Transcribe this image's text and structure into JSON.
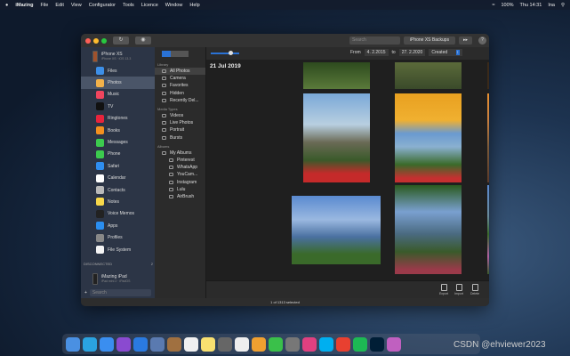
{
  "menubar": {
    "app": "iMazing",
    "items": [
      "File",
      "Edit",
      "View",
      "Configurator",
      "Tools",
      "Licence",
      "Window",
      "Help"
    ],
    "battery": "100%",
    "clock": "Thu 14:31",
    "user": "Ina"
  },
  "toolbar": {
    "search_placeholder": "Search",
    "backups_label": "iPhone XS Backups",
    "help": "?"
  },
  "sidebar": {
    "device": {
      "name": "iPhone XS",
      "sub": "iPhone XS · iOS 13.3"
    },
    "items": [
      {
        "label": "Files",
        "color": "#3d8fe8"
      },
      {
        "label": "Photos",
        "color": "#f3b24a",
        "selected": true
      },
      {
        "label": "Music",
        "color": "#f0455e"
      },
      {
        "label": "TV",
        "color": "#111111"
      },
      {
        "label": "Ringtones",
        "color": "#e8243c"
      },
      {
        "label": "Books",
        "color": "#f3901f"
      },
      {
        "label": "Messages",
        "color": "#3ccb4e"
      },
      {
        "label": "Phone",
        "color": "#3ccb4e"
      },
      {
        "label": "Safari",
        "color": "#2f8ef0"
      },
      {
        "label": "Calendar",
        "color": "#ffffff"
      },
      {
        "label": "Contacts",
        "color": "#b9b9b9"
      },
      {
        "label": "Notes",
        "color": "#f8d84a"
      },
      {
        "label": "Voice Memos",
        "color": "#222222"
      },
      {
        "label": "Apps",
        "color": "#2a8ef0"
      },
      {
        "label": "Profiles",
        "color": "#888888"
      },
      {
        "label": "File System",
        "color": "#f4f4f4"
      }
    ],
    "disconnected_label": "DISCONNECTED",
    "disconnected_count": "2",
    "ipad": {
      "name": "iMazing iPad",
      "sub": "iPad mini 2 · iPadOS"
    },
    "search_placeholder": "Search"
  },
  "library": {
    "sections": [
      {
        "title": "Library",
        "items": [
          "All Photos",
          "Camera",
          "Favorites",
          "Hidden",
          "Recently Del..."
        ]
      },
      {
        "title": "Media Types",
        "items": [
          "Videos",
          "Live Photos",
          "Portrait",
          "Bursts"
        ]
      },
      {
        "title": "Albums",
        "items": [
          "My Albums"
        ]
      }
    ],
    "albums": [
      "Pinterest",
      "WhatsApp",
      "YouCam...",
      "Instagram",
      "Lulu",
      "AirBrush"
    ],
    "selected": "All Photos"
  },
  "content": {
    "date_group": "21 Jul 2019",
    "from_label": "From",
    "from_date": "4. 2.2015",
    "to_label": "to",
    "to_date": "27. 2.2020",
    "sort": "Created",
    "thumb_size": 0.7
  },
  "actions": [
    "Export",
    "Import",
    "Delete"
  ],
  "status": "1 of 1313 selected",
  "watermark": "CSDN @ehviewer2023",
  "accent": "#2a72d5"
}
